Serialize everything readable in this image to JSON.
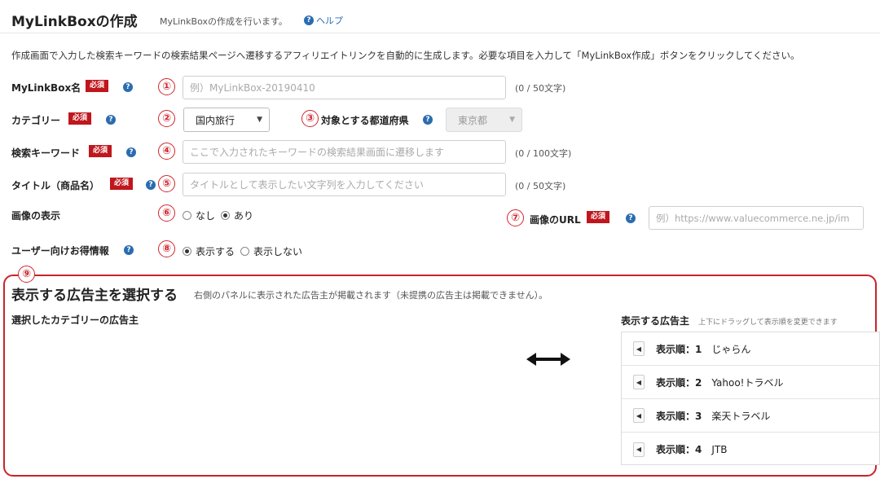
{
  "header": {
    "title": "MyLinkBoxの作成",
    "subtitle": "MyLinkBoxの作成を行います。",
    "help": "ヘルプ"
  },
  "description": "作成画面で入力した検索キーワードの検索結果ページへ遷移するアフィリエイトリンクを自動的に生成します。必要な項目を入力して「MyLinkBox作成」ボタンをクリックしてください。",
  "required_label": "必須",
  "help_icon_glyph": "?",
  "fields": {
    "name": {
      "label": "MyLinkBox名",
      "num": "①",
      "placeholder": "例）MyLinkBox-20190410",
      "count": "(0 / 50文字)"
    },
    "category": {
      "label": "カテゴリー",
      "num": "②",
      "value": "国内旅行"
    },
    "prefecture": {
      "label": "対象とする都道府県",
      "num": "③",
      "value": "東京都"
    },
    "keyword": {
      "label": "検索キーワード",
      "num": "④",
      "placeholder": "ここで入力されたキーワードの検索結果画面に遷移します",
      "count": "(0 / 100文字)"
    },
    "title": {
      "label": "タイトル（商品名）",
      "num": "⑤",
      "placeholder": "タイトルとして表示したい文字列を入力してください",
      "count": "(0 / 50文字)"
    },
    "image_display": {
      "label": "画像の表示",
      "num": "⑥",
      "option_none": "なし",
      "option_yes": "あり",
      "selected": "あり"
    },
    "image_url": {
      "label": "画像のURL",
      "num": "⑦",
      "placeholder": "例）https://www.valuecommerce.ne.jp/im"
    },
    "deals": {
      "label": "ユーザー向けお得情報",
      "num": "⑧",
      "option_show": "表示する",
      "option_hide": "表示しない",
      "selected": "表示する"
    }
  },
  "advertisers": {
    "num": "⑨",
    "title": "表示する広告主を選択する",
    "subtitle": "右側のパネルに表示された広告主が掲載されます（未提携の広告主は掲載できません）。",
    "left_title": "選択したカテゴリーの広告主",
    "right_title": "表示する広告主",
    "right_sub": "上下にドラッグして表示順を変更できます",
    "items": [
      {
        "order": "表示順：1",
        "name": "じゃらん"
      },
      {
        "order": "表示順：2",
        "name": "Yahoo!トラベル"
      },
      {
        "order": "表示順：3",
        "name": "楽天トラベル"
      },
      {
        "order": "表示順：4",
        "name": "JTB"
      }
    ]
  },
  "colors": {
    "accent_red": "#c8232c",
    "help_blue": "#2b6cb0"
  }
}
